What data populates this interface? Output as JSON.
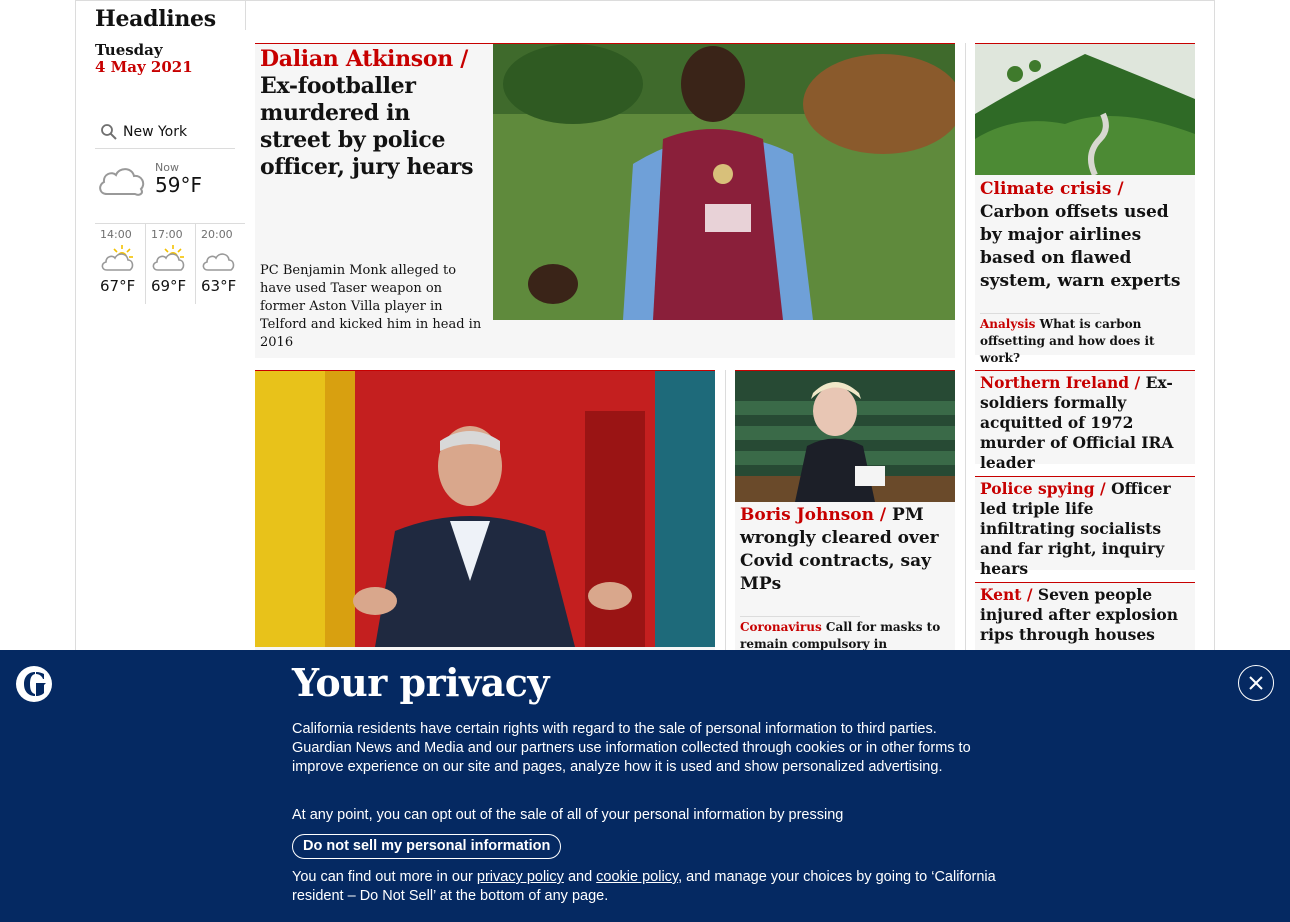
{
  "section": {
    "title": "Headlines",
    "day": "Tuesday",
    "date": "4 May 2021"
  },
  "weather": {
    "location": "New York",
    "now_label": "Now",
    "now_temp": "59°F",
    "now_icon": "cloud-icon",
    "forecast": [
      {
        "time": "14:00",
        "temp": "67°F",
        "icon": "partly-sunny-icon"
      },
      {
        "time": "17:00",
        "temp": "69°F",
        "icon": "partly-sunny-icon"
      },
      {
        "time": "20:00",
        "temp": "63°F",
        "icon": "cloud-icon"
      }
    ]
  },
  "lead": {
    "kicker": "Dalian Atkinson /",
    "headline": "Ex-footballer murdered in street by police officer, jury hears",
    "standfirst": "PC Benjamin Monk alleged to have used Taser weapon on former Aston Villa player in Telford and kicked him in head in 2016"
  },
  "climate": {
    "kicker": "Climate crisis /",
    "headline": "Carbon offsets used by major airlines based on flawed system, warn experts",
    "sub_kicker": "Analysis",
    "sub_text": "What is carbon offsetting and how does it work?"
  },
  "northern_ireland": {
    "kicker": "Northern Ireland /",
    "headline": "Ex-soldiers formally acquitted of 1972 murder of Official IRA leader"
  },
  "police_spying": {
    "kicker": "Police spying /",
    "headline": "Officer led triple life infiltrating socialists and far right, inquiry hears"
  },
  "kent": {
    "kicker": "Kent /",
    "headline": "Seven people injured after explosion rips through houses"
  },
  "boris": {
    "kicker": "Boris Johnson /",
    "headline": "PM wrongly cleared over Covid contracts, say MPs",
    "sub_kicker": "Coronavirus",
    "sub_text": "Call for masks to remain compulsory in England's"
  },
  "banner": {
    "title": "Your privacy",
    "p1": "California residents have certain rights with regard to the sale of personal information to third parties. Guardian News and Media and our partners use information collected through cookies or in other forms to improve experience on our site and pages, analyze how it is used and show personalized advertising.",
    "p2": "At any point, you can opt out of the sale of all of your personal information by pressing",
    "button": "Do not sell my personal information",
    "p3_a": "You can find out more in our",
    "privacy_link": "privacy policy",
    "p3_and": "and",
    "cookie_link": "cookie policy",
    "p3_b": ", and manage your choices by going to ‘California resident – Do Not Sell’ at the bottom of any page."
  },
  "colors": {
    "accent": "#c70000",
    "banner_bg": "#052962",
    "card_bg": "#f6f6f6"
  }
}
